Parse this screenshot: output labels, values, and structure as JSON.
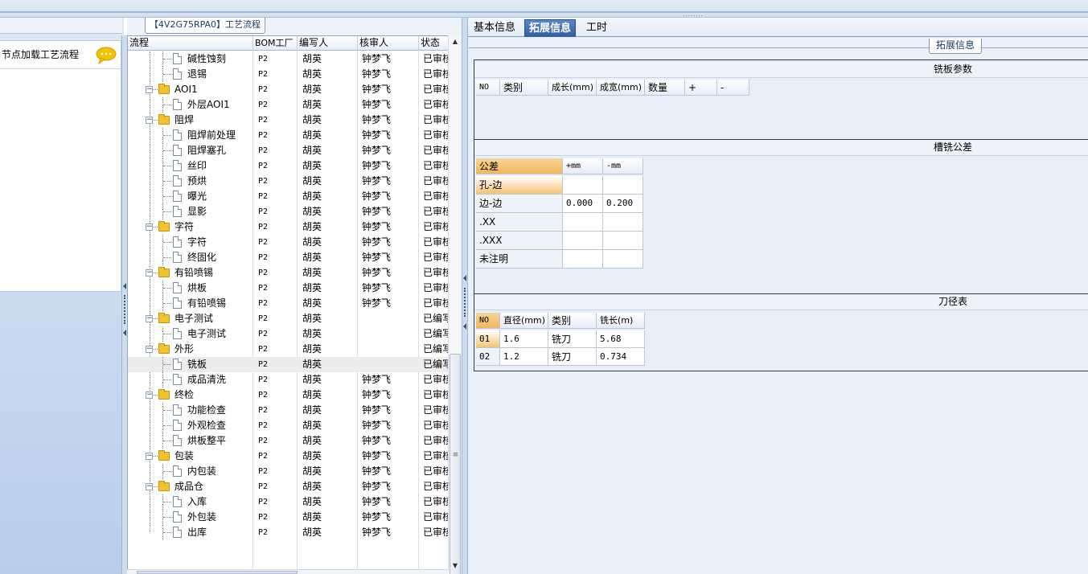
{
  "top_grip": "........",
  "left_panel": {
    "node_label": "节点加载工艺流程",
    "chat_icon": "speech-bubble-icon",
    "chat_icon_color": "#f0c400"
  },
  "center": {
    "caption": "【4V2G75RPA0】工艺流程",
    "columns": [
      "流程",
      "BOM工厂",
      "编写人",
      "核审人",
      "状态"
    ],
    "rows": [
      {
        "name": "碱性蚀刻",
        "level": 2,
        "type": "doc",
        "bom": "P2",
        "writer": "胡英",
        "reviewer": "钟梦飞",
        "status": "已审核"
      },
      {
        "name": "退锡",
        "level": 2,
        "type": "doc",
        "bom": "P2",
        "writer": "胡英",
        "reviewer": "钟梦飞",
        "status": "已审核"
      },
      {
        "name": "AOI1",
        "level": 1,
        "type": "folder",
        "bom": "P2",
        "writer": "胡英",
        "reviewer": "钟梦飞",
        "status": "已审核"
      },
      {
        "name": "外层AOI1",
        "level": 2,
        "type": "doc",
        "bom": "P2",
        "writer": "胡英",
        "reviewer": "钟梦飞",
        "status": "已审核"
      },
      {
        "name": "阻焊",
        "level": 1,
        "type": "folder",
        "bom": "P2",
        "writer": "胡英",
        "reviewer": "钟梦飞",
        "status": "已审核"
      },
      {
        "name": "阻焊前处理",
        "level": 2,
        "type": "doc",
        "bom": "P2",
        "writer": "胡英",
        "reviewer": "钟梦飞",
        "status": "已审核"
      },
      {
        "name": "阻焊塞孔",
        "level": 2,
        "type": "doc",
        "bom": "P2",
        "writer": "胡英",
        "reviewer": "钟梦飞",
        "status": "已审核"
      },
      {
        "name": "丝印",
        "level": 2,
        "type": "doc",
        "bom": "P2",
        "writer": "胡英",
        "reviewer": "钟梦飞",
        "status": "已审核"
      },
      {
        "name": "预烘",
        "level": 2,
        "type": "doc",
        "bom": "P2",
        "writer": "胡英",
        "reviewer": "钟梦飞",
        "status": "已审核"
      },
      {
        "name": "曝光",
        "level": 2,
        "type": "doc",
        "bom": "P2",
        "writer": "胡英",
        "reviewer": "钟梦飞",
        "status": "已审核"
      },
      {
        "name": "显影",
        "level": 2,
        "type": "doc",
        "bom": "P2",
        "writer": "胡英",
        "reviewer": "钟梦飞",
        "status": "已审核"
      },
      {
        "name": "字符",
        "level": 1,
        "type": "folder",
        "bom": "P2",
        "writer": "胡英",
        "reviewer": "钟梦飞",
        "status": "已审核"
      },
      {
        "name": "字符",
        "level": 2,
        "type": "doc",
        "bom": "P2",
        "writer": "胡英",
        "reviewer": "钟梦飞",
        "status": "已审核"
      },
      {
        "name": "终固化",
        "level": 2,
        "type": "doc",
        "bom": "P2",
        "writer": "胡英",
        "reviewer": "钟梦飞",
        "status": "已审核"
      },
      {
        "name": "有铅喷锡",
        "level": 1,
        "type": "folder",
        "bom": "P2",
        "writer": "胡英",
        "reviewer": "钟梦飞",
        "status": "已审核"
      },
      {
        "name": "烘板",
        "level": 2,
        "type": "doc",
        "bom": "P2",
        "writer": "胡英",
        "reviewer": "钟梦飞",
        "status": "已审核"
      },
      {
        "name": "有铅喷锡",
        "level": 2,
        "type": "doc",
        "bom": "P2",
        "writer": "胡英",
        "reviewer": "钟梦飞",
        "status": "已审核"
      },
      {
        "name": "电子测试",
        "level": 1,
        "type": "folder",
        "bom": "P2",
        "writer": "胡英",
        "reviewer": "",
        "status": "已编写"
      },
      {
        "name": "电子测试",
        "level": 2,
        "type": "doc",
        "bom": "P2",
        "writer": "胡英",
        "reviewer": "",
        "status": "已编写"
      },
      {
        "name": "外形",
        "level": 1,
        "type": "folder",
        "bom": "P2",
        "writer": "胡英",
        "reviewer": "",
        "status": "已编写"
      },
      {
        "name": "铣板",
        "level": 2,
        "type": "doc",
        "bom": "P2",
        "writer": "胡英",
        "reviewer": "",
        "status": "已编写",
        "selected": true
      },
      {
        "name": "成品清洗",
        "level": 2,
        "type": "doc",
        "bom": "P2",
        "writer": "胡英",
        "reviewer": "钟梦飞",
        "status": "已审核"
      },
      {
        "name": "终检",
        "level": 1,
        "type": "folder",
        "bom": "P2",
        "writer": "胡英",
        "reviewer": "钟梦飞",
        "status": "已审核"
      },
      {
        "name": "功能检查",
        "level": 2,
        "type": "doc",
        "bom": "P2",
        "writer": "胡英",
        "reviewer": "钟梦飞",
        "status": "已审核"
      },
      {
        "name": "外观检查",
        "level": 2,
        "type": "doc",
        "bom": "P2",
        "writer": "胡英",
        "reviewer": "钟梦飞",
        "status": "已审核"
      },
      {
        "name": "烘板整平",
        "level": 2,
        "type": "doc",
        "bom": "P2",
        "writer": "胡英",
        "reviewer": "钟梦飞",
        "status": "已审核"
      },
      {
        "name": "包装",
        "level": 1,
        "type": "folder",
        "bom": "P2",
        "writer": "胡英",
        "reviewer": "钟梦飞",
        "status": "已审核"
      },
      {
        "name": "内包装",
        "level": 2,
        "type": "doc",
        "bom": "P2",
        "writer": "胡英",
        "reviewer": "钟梦飞",
        "status": "已审核"
      },
      {
        "name": "成品仓",
        "level": 1,
        "type": "folder",
        "bom": "P2",
        "writer": "胡英",
        "reviewer": "钟梦飞",
        "status": "已审核"
      },
      {
        "name": "入库",
        "level": 2,
        "type": "doc",
        "bom": "P2",
        "writer": "胡英",
        "reviewer": "钟梦飞",
        "status": "已审核"
      },
      {
        "name": "外包装",
        "level": 2,
        "type": "doc",
        "bom": "P2",
        "writer": "胡英",
        "reviewer": "钟梦飞",
        "status": "已审核"
      },
      {
        "name": "出库",
        "level": 2,
        "type": "doc",
        "bom": "P2",
        "writer": "胡英",
        "reviewer": "钟梦飞",
        "status": "已审核"
      }
    ]
  },
  "right": {
    "tabs": [
      {
        "label": "基本信息",
        "active": false
      },
      {
        "label": "拓展信息",
        "active": true
      },
      {
        "label": "工时",
        "active": false
      }
    ],
    "caption": "拓展信息",
    "panel1": {
      "title": "铣板参数",
      "headers": [
        "NO",
        "类别",
        "成长(mm)",
        "成宽(mm)",
        "数量",
        "+",
        "-"
      ]
    },
    "panel2": {
      "title": "槽铣公差",
      "headers": [
        "公差",
        "+mm",
        "-mm"
      ],
      "rows": [
        {
          "label": "孔-边",
          "plus": "",
          "minus": ""
        },
        {
          "label": "边-边",
          "plus": "0.000",
          "minus": "0.200"
        },
        {
          "label": ".XX",
          "plus": "",
          "minus": ""
        },
        {
          "label": ".XXX",
          "plus": "",
          "minus": ""
        },
        {
          "label": "未注明",
          "plus": "",
          "minus": ""
        }
      ]
    },
    "panel3": {
      "title": "刀径表",
      "headers": [
        "NO",
        "直径(mm)",
        "类别",
        "铣长(m)"
      ],
      "rows": [
        {
          "no": "01",
          "dia": "1.6",
          "type": "铣刀",
          "len": "5.68"
        },
        {
          "no": "02",
          "dia": "1.2",
          "type": "铣刀",
          "len": "0.734"
        }
      ]
    }
  }
}
